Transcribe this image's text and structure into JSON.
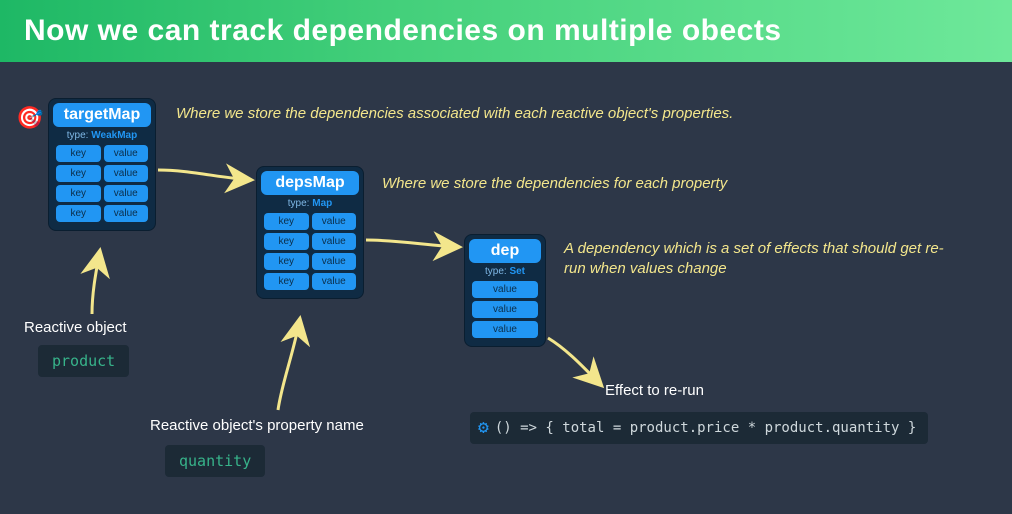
{
  "header": {
    "title": "Now we can track dependencies on multiple obects"
  },
  "targetMap": {
    "title": "targetMap",
    "typeLabel": "type:",
    "typeValue": "WeakMap",
    "desc": "Where we store the dependencies associated with each reactive object's properties.",
    "rows": [
      {
        "key": "key",
        "value": "value"
      },
      {
        "key": "key",
        "value": "value"
      },
      {
        "key": "key",
        "value": "value"
      },
      {
        "key": "key",
        "value": "value"
      }
    ]
  },
  "depsMap": {
    "title": "depsMap",
    "typeLabel": "type:",
    "typeValue": "Map",
    "desc": "Where we store the dependencies for each property",
    "rows": [
      {
        "key": "key",
        "value": "value"
      },
      {
        "key": "key",
        "value": "value"
      },
      {
        "key": "key",
        "value": "value"
      },
      {
        "key": "key",
        "value": "value"
      }
    ]
  },
  "dep": {
    "title": "dep",
    "typeLabel": "type:",
    "typeValue": "Set",
    "desc": "A dependency which is a set of effects that should get re-run when values change",
    "rows": [
      {
        "value": "value"
      },
      {
        "value": "value"
      },
      {
        "value": "value"
      }
    ]
  },
  "labels": {
    "reactiveObject": "Reactive object",
    "reactivePropName": "Reactive object's property name",
    "effectToRerun": "Effect to re-run"
  },
  "chips": {
    "product": "product",
    "quantity": "quantity"
  },
  "effectCode": {
    "raw": "() => { total = product.price * product.quantity }"
  }
}
